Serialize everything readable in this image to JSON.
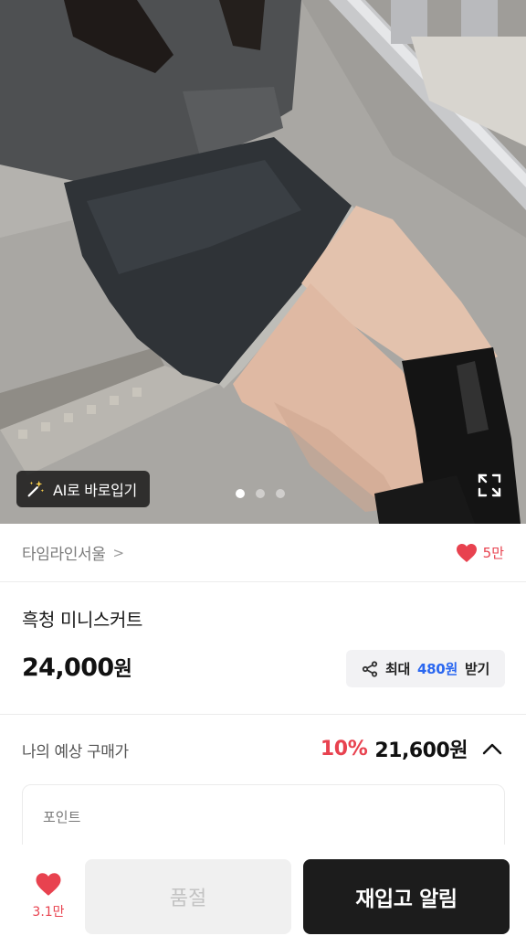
{
  "hero": {
    "ai_chip_label": "AI로 바로입기",
    "ai_chip_icon": "magic-wand-icon",
    "carousel": {
      "total": 3,
      "active": 1
    },
    "expand_icon": "expand-icon"
  },
  "shop": {
    "name": "타임라인서울",
    "chevron": ">",
    "likes": "5만",
    "heart_icon": "heart-icon"
  },
  "product": {
    "title": "흑청 미니스커트",
    "price_number": "24,000",
    "price_unit": "원"
  },
  "share": {
    "prefix": "최대",
    "amount": "480원",
    "suffix": "받기",
    "icon": "share-icon"
  },
  "expected": {
    "label": "나의 예상 구매가",
    "discount": "10%",
    "final_price": "21,600원",
    "caret_icon": "caret-up-icon"
  },
  "point_card": {
    "label": "포인트"
  },
  "bottom_bar": {
    "wish_count": "3.1만",
    "soldout_label": "품절",
    "restock_label": "재입고 알림"
  },
  "colors": {
    "accent_red": "#e8424f",
    "accent_blue": "#2a67f0",
    "dark_button": "#1c1c1c"
  }
}
